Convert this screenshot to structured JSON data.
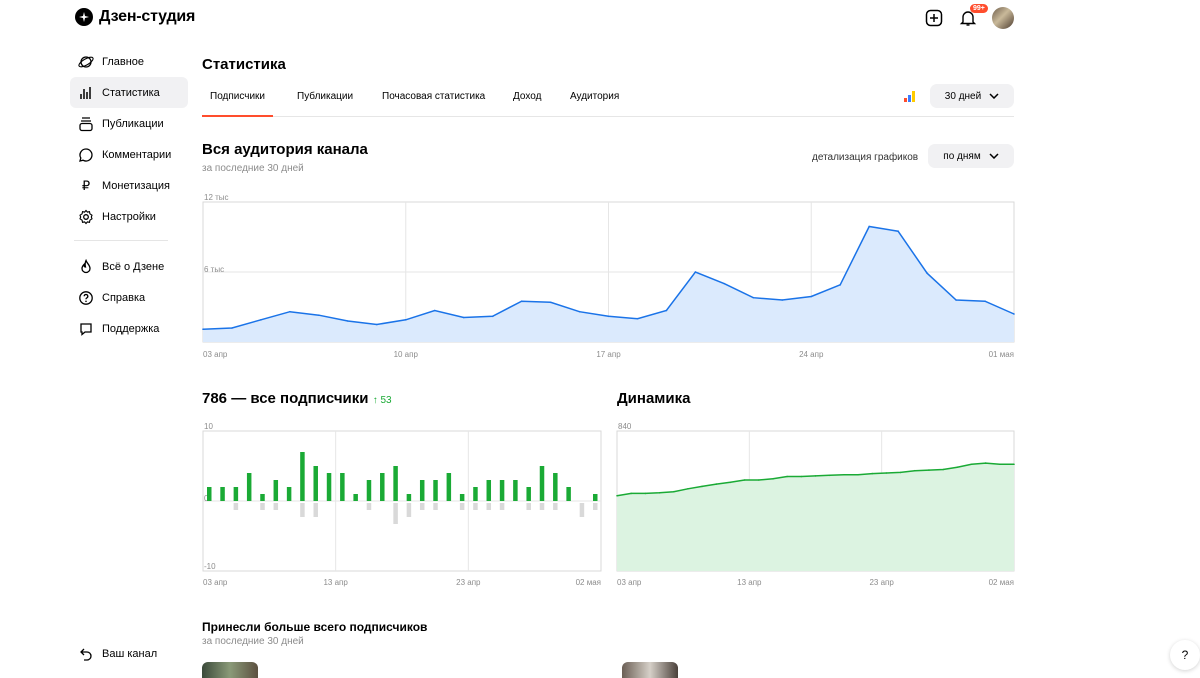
{
  "app": {
    "title": "Дзен-студия",
    "notification_badge": "99+"
  },
  "sidebar": {
    "items": [
      {
        "label": "Главное",
        "icon": "planet-icon"
      },
      {
        "label": "Статистика",
        "icon": "stats-icon",
        "active": true
      },
      {
        "label": "Публикации",
        "icon": "publications-icon"
      },
      {
        "label": "Комментарии",
        "icon": "comment-icon"
      },
      {
        "label": "Монетизация",
        "icon": "ruble-icon"
      },
      {
        "label": "Настройки",
        "icon": "gear-icon"
      }
    ],
    "items2": [
      {
        "label": "Всё о Дзене",
        "icon": "flame-icon"
      },
      {
        "label": "Справка",
        "icon": "help-circle-icon"
      },
      {
        "label": "Поддержка",
        "icon": "support-icon"
      }
    ],
    "your_channel": "Ваш канал"
  },
  "page": {
    "title": "Статистика"
  },
  "tabs": [
    "Подписчики",
    "Публикации",
    "Почасовая статистика",
    "Доход",
    "Аудитория"
  ],
  "period": {
    "value": "30 дней"
  },
  "audience": {
    "title": "Вся аудитория канала",
    "subtitle": "за последние 30 дней",
    "detail_label": "детализация графиков",
    "detail_value": "по дням"
  },
  "subscribers": {
    "title": "786 — все подписчики",
    "delta": "↑ 53"
  },
  "dynamics": {
    "title": "Динамика"
  },
  "top": {
    "title": "Принесли больше всего подписчиков",
    "subtitle": "за последние 30 дней"
  },
  "help_label": "?",
  "colors": {
    "accent": "#ff4d2d",
    "blue": "#1a73e8",
    "green": "#1aaa35",
    "gray_bar": "#d9d9d9"
  },
  "chart_data": [
    {
      "type": "area",
      "ylim": [
        0,
        12000
      ],
      "yticks": [
        "12 тыс",
        "6 тыс",
        "0"
      ],
      "xticks": [
        "03 апр",
        "10 апр",
        "17 апр",
        "24 апр",
        "01 мая"
      ],
      "x": [
        "03 апр",
        "04 апр",
        "05 апр",
        "06 апр",
        "07 апр",
        "08 апр",
        "09 апр",
        "10 апр",
        "11 апр",
        "12 апр",
        "13 апр",
        "14 апр",
        "15 апр",
        "16 апр",
        "17 апр",
        "18 апр",
        "19 апр",
        "20 апр",
        "21 апр",
        "22 апр",
        "23 апр",
        "24 апр",
        "25 апр",
        "26 апр",
        "27 апр",
        "28 апр",
        "29 апр",
        "30 апр",
        "01 мая"
      ],
      "values": [
        1100,
        1200,
        1900,
        2600,
        2300,
        1800,
        1500,
        1900,
        2700,
        2100,
        2200,
        3500,
        3400,
        2600,
        2200,
        2000,
        2700,
        6000,
        5000,
        3800,
        3600,
        3900,
        4900,
        9900,
        9500,
        5900,
        3600,
        3500,
        2400
      ],
      "grid": true
    },
    {
      "type": "bar",
      "ylim": [
        -10,
        10
      ],
      "yticks": [
        "10",
        "0",
        "-10"
      ],
      "xticks": [
        "03 апр",
        "13 апр",
        "23 апр",
        "02 мая"
      ],
      "series": [
        {
          "values": [
            2,
            2,
            2,
            4,
            1,
            3,
            2,
            7,
            5,
            4,
            4,
            1,
            3,
            4,
            5,
            1,
            3,
            3,
            4,
            1,
            2,
            3,
            3,
            3,
            2,
            5,
            4,
            2,
            0,
            1
          ]
        },
        {
          "values": [
            0,
            0,
            -1,
            0,
            -1,
            -1,
            0,
            -2,
            -2,
            0,
            0,
            0,
            -1,
            0,
            -3,
            -2,
            -1,
            -1,
            0,
            -1,
            -1,
            -1,
            -1,
            0,
            -1,
            -1,
            -1,
            0,
            -2,
            -1
          ]
        }
      ],
      "grid": true
    },
    {
      "type": "area",
      "ylim": [
        600,
        840
      ],
      "yticks": [
        "840",
        "720",
        "600"
      ],
      "xticks": [
        "03 апр",
        "13 апр",
        "23 апр",
        "02 мая"
      ],
      "values": [
        729,
        733,
        733,
        734,
        736,
        741,
        745,
        749,
        752,
        756,
        756,
        758,
        762,
        762,
        763,
        764,
        765,
        765,
        767,
        768,
        769,
        772,
        773,
        774,
        778,
        783,
        785,
        783,
        783
      ],
      "grid": true
    }
  ]
}
